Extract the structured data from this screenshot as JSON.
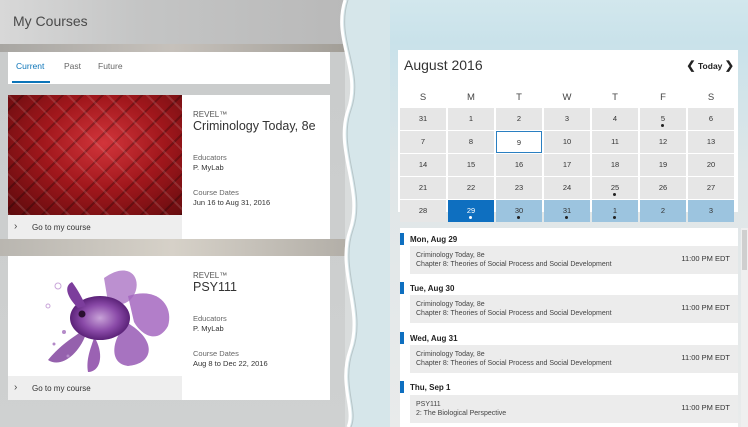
{
  "left_panel": {
    "title": "My Courses",
    "tabs": [
      {
        "label": "Current",
        "active": true
      },
      {
        "label": "Past",
        "active": false
      },
      {
        "label": "Future",
        "active": false
      }
    ],
    "courses": [
      {
        "brand": "REVEL™",
        "title": "Criminology Today, 8e",
        "educators_label": "Educators",
        "educators": "P. MyLab",
        "dates_label": "Course Dates",
        "dates": "Jun 16 to Aug 31, 2016",
        "go_label": "Go to my course"
      },
      {
        "brand": "REVEL™",
        "title": "PSY111",
        "educators_label": "Educators",
        "educators": "P. MyLab",
        "dates_label": "Course Dates",
        "dates": "Aug 8 to Dec 22, 2016",
        "go_label": "Go to my course"
      }
    ]
  },
  "calendar": {
    "month": "August 2016",
    "today_label": "Today",
    "prev_icon": "chevron-left-icon",
    "next_icon": "chevron-right-icon",
    "weekdays": [
      "S",
      "M",
      "T",
      "W",
      "T",
      "F",
      "S"
    ],
    "weeks": [
      [
        {
          "d": "31"
        },
        {
          "d": "1"
        },
        {
          "d": "2"
        },
        {
          "d": "3"
        },
        {
          "d": "4"
        },
        {
          "d": "5",
          "dot": true
        },
        {
          "d": "6"
        }
      ],
      [
        {
          "d": "7"
        },
        {
          "d": "8"
        },
        {
          "d": "9",
          "today": true
        },
        {
          "d": "10"
        },
        {
          "d": "11"
        },
        {
          "d": "12"
        },
        {
          "d": "13"
        }
      ],
      [
        {
          "d": "14"
        },
        {
          "d": "15"
        },
        {
          "d": "16"
        },
        {
          "d": "17"
        },
        {
          "d": "18"
        },
        {
          "d": "19"
        },
        {
          "d": "20"
        }
      ],
      [
        {
          "d": "21"
        },
        {
          "d": "22"
        },
        {
          "d": "23"
        },
        {
          "d": "24"
        },
        {
          "d": "25",
          "dot": true
        },
        {
          "d": "26"
        },
        {
          "d": "27"
        }
      ],
      [
        {
          "d": "28"
        },
        {
          "d": "29",
          "dot": true,
          "sel": true
        },
        {
          "d": "30",
          "dot": true,
          "selrow": true
        },
        {
          "d": "31",
          "dot": true,
          "selrow": true
        },
        {
          "d": "1",
          "dot": true,
          "selrow": true
        },
        {
          "d": "2",
          "selrow": true
        },
        {
          "d": "3",
          "selrow": true
        }
      ]
    ],
    "accent": "#0e6fc0"
  },
  "agenda": [
    {
      "date": "Mon, Aug 29",
      "course": "Criminology Today, 8e",
      "chapter": "Chapter 8: Theories of Social Process and Social Development",
      "time": "11:00 PM EDT"
    },
    {
      "date": "Tue, Aug 30",
      "course": "Criminology Today, 8e",
      "chapter": "Chapter 8: Theories of Social Process and Social Development",
      "time": "11:00 PM EDT"
    },
    {
      "date": "Wed, Aug 31",
      "course": "Criminology Today, 8e",
      "chapter": "Chapter 8: Theories of Social Process and Social Development",
      "time": "11:00 PM EDT"
    },
    {
      "date": "Thu, Sep 1",
      "course": "PSY111",
      "chapter": "2: The Biological Perspective",
      "time": "11:00 PM EDT"
    }
  ]
}
